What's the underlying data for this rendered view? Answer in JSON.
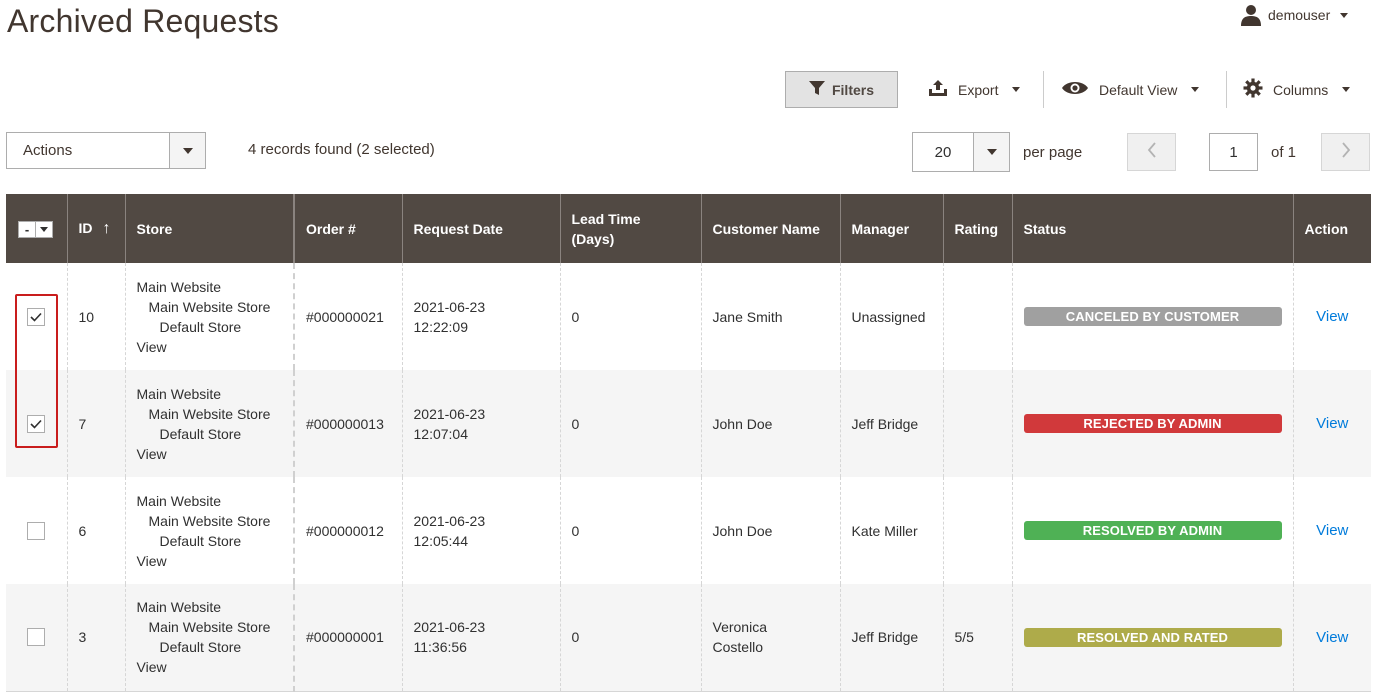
{
  "page": {
    "title": "Archived Requests"
  },
  "user": {
    "name": "demouser"
  },
  "toolbar": {
    "filters_label": "Filters",
    "export_label": "Export",
    "view_label": "Default View",
    "columns_label": "Columns"
  },
  "actions": {
    "label": "Actions"
  },
  "records": {
    "text": "4 records found (2 selected)"
  },
  "pager": {
    "per_page_value": "20",
    "per_page_label": "per page",
    "current_page": "1",
    "of_label": "of 1"
  },
  "grid": {
    "headers": {
      "id": "ID",
      "sort_arrow": "↑",
      "store": "Store",
      "order": "Order #",
      "request_date": "Request Date",
      "lead_time_1": "Lead Time",
      "lead_time_2": "(Days)",
      "customer": "Customer Name",
      "manager": "Manager",
      "rating": "Rating",
      "status": "Status",
      "action": "Action"
    },
    "mass_select_label": "-",
    "rows": [
      {
        "checked": true,
        "id": "10",
        "store": [
          "Main Website",
          "Main Website Store",
          "Default Store",
          "View"
        ],
        "order": "#000000021",
        "date": "2021-06-23",
        "time": "12:22:09",
        "lead": "0",
        "customer": [
          "Jane Smith"
        ],
        "manager": "Unassigned",
        "rating": "",
        "status": "CANCELED BY CUSTOMER",
        "status_color": "#a0a0a0",
        "action": "View"
      },
      {
        "checked": true,
        "id": "7",
        "store": [
          "Main Website",
          "Main Website Store",
          "Default Store",
          "View"
        ],
        "order": "#000000013",
        "date": "2021-06-23",
        "time": "12:07:04",
        "lead": "0",
        "customer": [
          "John Doe"
        ],
        "manager": "Jeff Bridge",
        "rating": "",
        "status": "REJECTED BY ADMIN",
        "status_color": "#d1393b",
        "action": "View"
      },
      {
        "checked": false,
        "id": "6",
        "store": [
          "Main Website",
          "Main Website Store",
          "Default Store",
          "View"
        ],
        "order": "#000000012",
        "date": "2021-06-23",
        "time": "12:05:44",
        "lead": "0",
        "customer": [
          "John Doe"
        ],
        "manager": "Kate Miller",
        "rating": "",
        "status": "RESOLVED BY ADMIN",
        "status_color": "#4fb155",
        "action": "View"
      },
      {
        "checked": false,
        "id": "3",
        "store": [
          "Main Website",
          "Main Website Store",
          "Default Store",
          "View"
        ],
        "order": "#000000001",
        "date": "2021-06-23",
        "time": "11:36:56",
        "lead": "0",
        "customer": [
          "Veronica",
          "Costello"
        ],
        "manager": "Jeff Bridge",
        "rating": "5/5",
        "status": "RESOLVED AND RATED",
        "status_color": "#aeab4a",
        "action": "View"
      }
    ]
  },
  "colors": {
    "header_bg": "#514943",
    "link": "#007bdb",
    "highlight": "#c91d1d"
  }
}
